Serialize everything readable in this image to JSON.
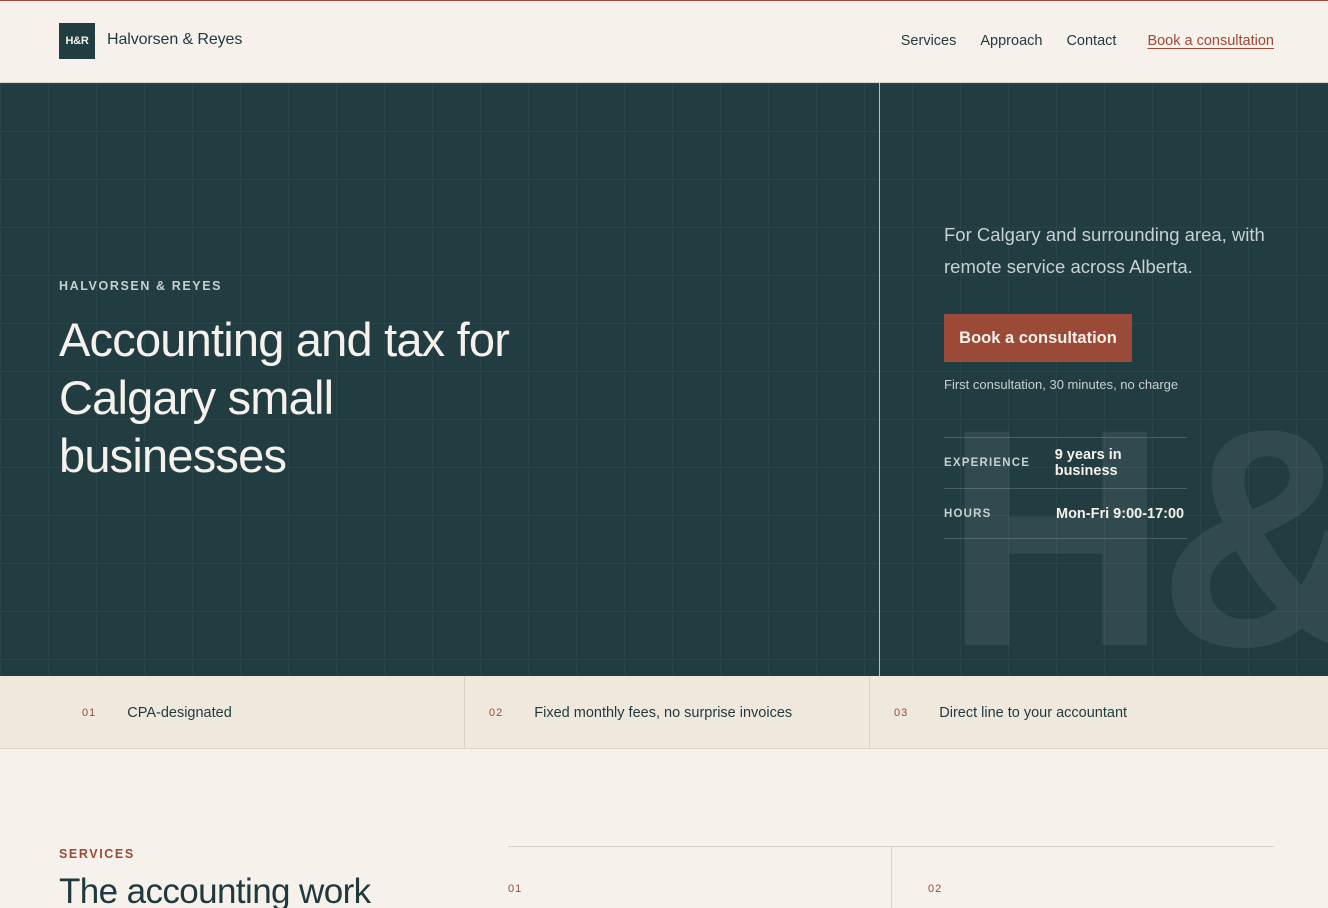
{
  "header": {
    "logo_mark": "H&R",
    "brand_name": "Halvorsen & Reyes",
    "nav": [
      "Services",
      "Approach",
      "Contact"
    ],
    "cta_label": "Book a consultation"
  },
  "hero": {
    "eyebrow": "HALVORSEN & REYES",
    "title": "Accounting and tax for Calgary small businesses",
    "watermark": "H&",
    "lede": "For Calgary and surrounding area, with remote service across Alberta.",
    "cta_label": "Book a consultation",
    "cta_note": "First consultation, 30 minutes, no charge",
    "facts": [
      {
        "label": "EXPERIENCE",
        "value": "9 years in business"
      },
      {
        "label": "HOURS",
        "value": "Mon-Fri 9:00-17:00"
      }
    ]
  },
  "strip": [
    {
      "num": "01",
      "text": "CPA-designated"
    },
    {
      "num": "02",
      "text": "Fixed monthly fees, no surprise invoices"
    },
    {
      "num": "03",
      "text": "Direct line to your accountant"
    }
  ],
  "services": {
    "eyebrow": "SERVICES",
    "title": "The accounting work",
    "items": [
      {
        "num": "01"
      },
      {
        "num": "02"
      }
    ]
  },
  "colors": {
    "primary": "#213d42",
    "accent": "#9a4a36",
    "background": "#f6f1ea",
    "strip": "#efe8dc"
  }
}
